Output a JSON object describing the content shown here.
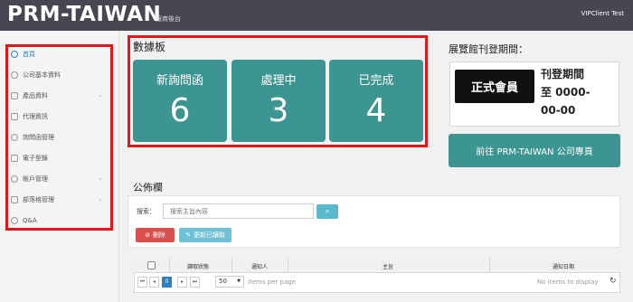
{
  "header": {
    "logo": "PRM-TAIWAN",
    "logo_sub": "廠商後台",
    "user": "VIPClient Test"
  },
  "sidebar": {
    "items": [
      {
        "label": "首頁",
        "icon": "chat-bubble-icon",
        "active": true
      },
      {
        "label": "公司基本資料",
        "icon": "user-icon"
      },
      {
        "label": "產品資料",
        "icon": "cart-icon",
        "has_sub": true
      },
      {
        "label": "代理資訊",
        "icon": "agent-icon"
      },
      {
        "label": "詢問函管理",
        "icon": "chat-bubble-icon"
      },
      {
        "label": "電子型錄",
        "icon": "catalog-icon"
      },
      {
        "label": "帳戶管理",
        "icon": "account-icon",
        "has_sub": true
      },
      {
        "label": "部落格管理",
        "icon": "edit-icon",
        "has_sub": true
      },
      {
        "label": "Q&A",
        "icon": "question-icon"
      }
    ]
  },
  "dashboard": {
    "title": "數據板",
    "stats": [
      {
        "label": "新詢問函",
        "value": "6"
      },
      {
        "label": "處理中",
        "value": "3"
      },
      {
        "label": "已完成",
        "value": "4"
      }
    ]
  },
  "exhibition": {
    "title": "展覽館刊登期間：",
    "member_badge": "正式會員",
    "period_label": "刊登期間",
    "period_value_1": "至 0000-",
    "period_value_2": "00-00",
    "go_button": "前往 PRM-TAIWAN 公司專頁"
  },
  "announcements": {
    "title": "公佈欄",
    "search_label": "搜索：",
    "search_placeholder": "搜索主旨內容",
    "delete_button": "刪除",
    "update_button": "更新已讀取",
    "columns": [
      "讀取狀態",
      "通知人",
      "主旨",
      "通知日期"
    ],
    "pager": {
      "page_size": "50",
      "per_page_text": "items per page",
      "empty_text": "No items to display",
      "current_page": "0"
    }
  },
  "colors": {
    "accent_teal": "#3c9591",
    "highlight_red": "#e3161c",
    "topbar": "#474754"
  }
}
